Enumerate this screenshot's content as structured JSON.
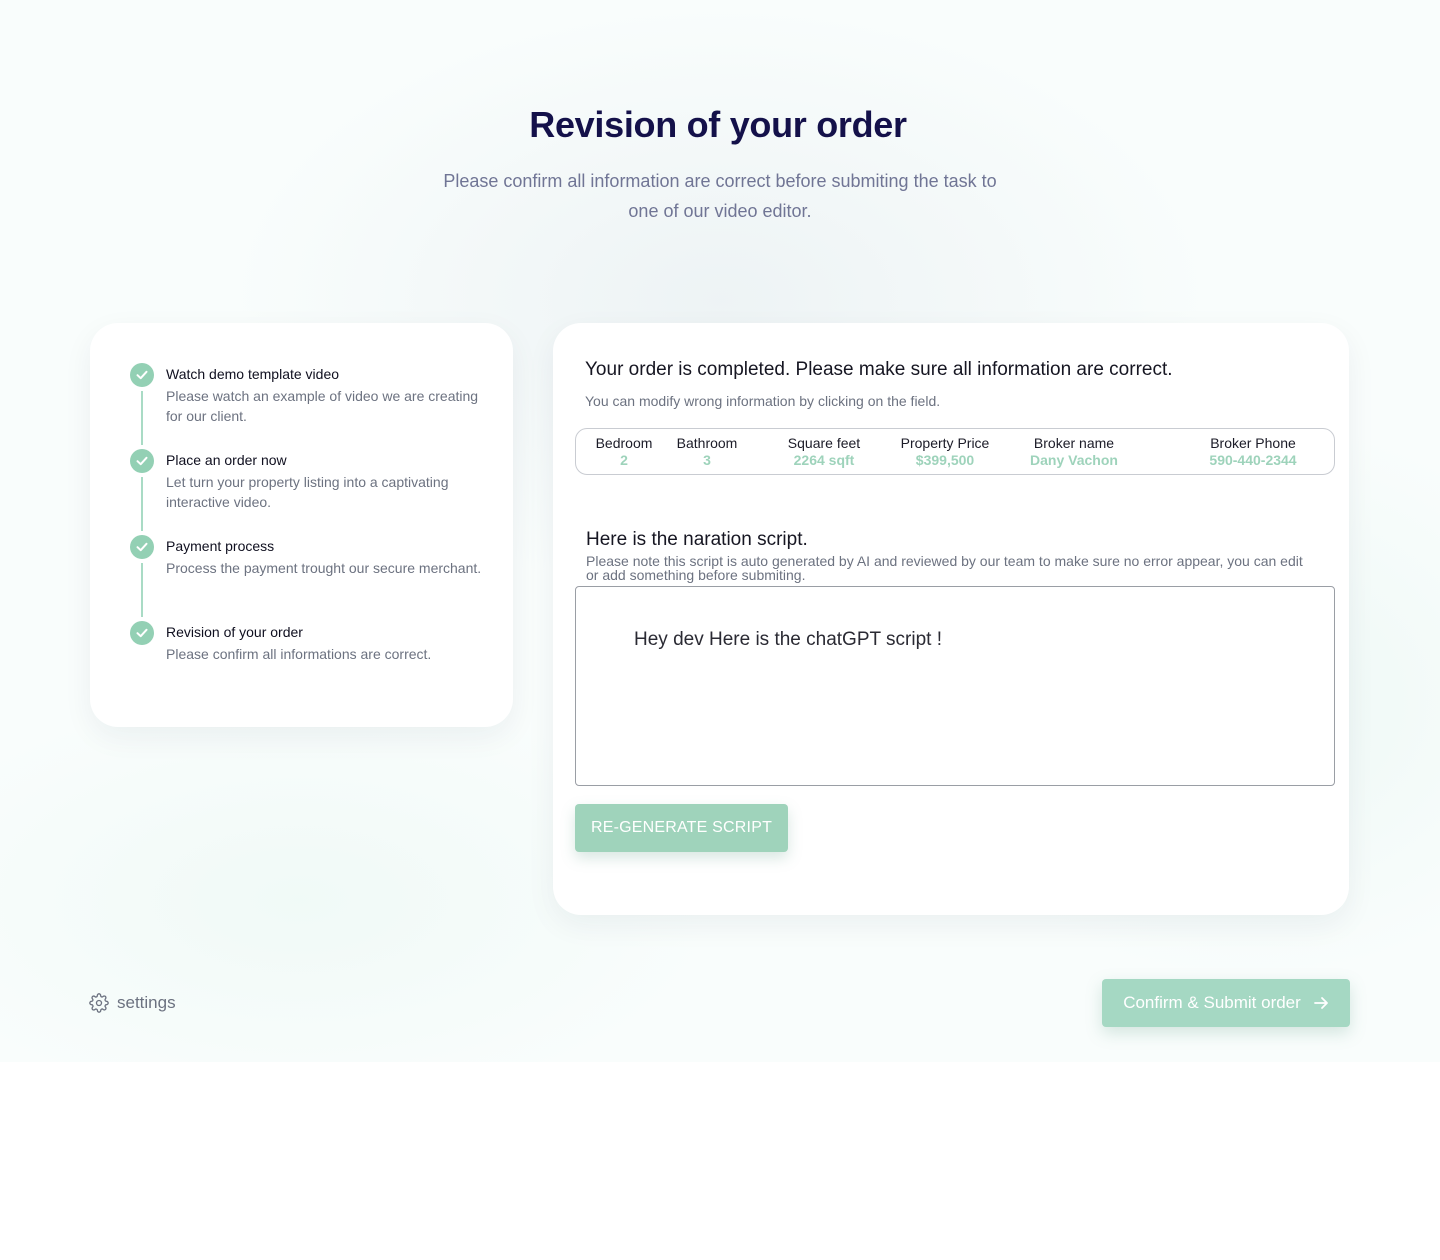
{
  "header": {
    "title": "Revision of your order",
    "subtitle": "Please confirm all information are correct before submiting the task to one of our video editor."
  },
  "steps": [
    {
      "title": "Watch demo template video",
      "desc": "Please watch an example of video we are creating for our client.",
      "status": "done"
    },
    {
      "title": "Place an order now",
      "desc": "Let turn your property listing into a captivating interactive video.",
      "status": "done"
    },
    {
      "title": "Payment process",
      "desc": "Process the payment trought our secure merchant.",
      "status": "done"
    },
    {
      "title": "Revision of your order",
      "desc": "Please confirm all informations are correct.",
      "status": "done"
    }
  ],
  "order": {
    "title": "Your order is completed. Please make sure all information are correct.",
    "subtitle": "You can modify wrong information by clicking on the field.",
    "details": [
      {
        "label": "Bedroom",
        "value": "2"
      },
      {
        "label": "Bathroom",
        "value": "3"
      },
      {
        "label": "Square feet",
        "value": "2264 sqft"
      },
      {
        "label": "Property Price",
        "value": "$399,500"
      },
      {
        "label": "Broker name",
        "value": "Dany Vachon"
      },
      {
        "label": "Broker Phone",
        "value": "590-440-2344"
      }
    ],
    "script_title": "Here is the naration script.",
    "script_note": "Please note this script is auto generated by AI and reviewed by our team to make sure no error appear, you can edit or add something before submiting.",
    "script_text": "Hey dev Here is the chatGPT script !",
    "regenerate_label": "RE-GENERATE SCRIPT"
  },
  "footer": {
    "settings_label": "settings",
    "submit_label": "Confirm & Submit order"
  },
  "colors": {
    "accent": "#9fd3bb",
    "title": "#14114a",
    "muted": "#6c7280"
  },
  "icons": {
    "step": "check-icon",
    "settings": "gear-icon",
    "submit": "arrow-right-icon"
  }
}
